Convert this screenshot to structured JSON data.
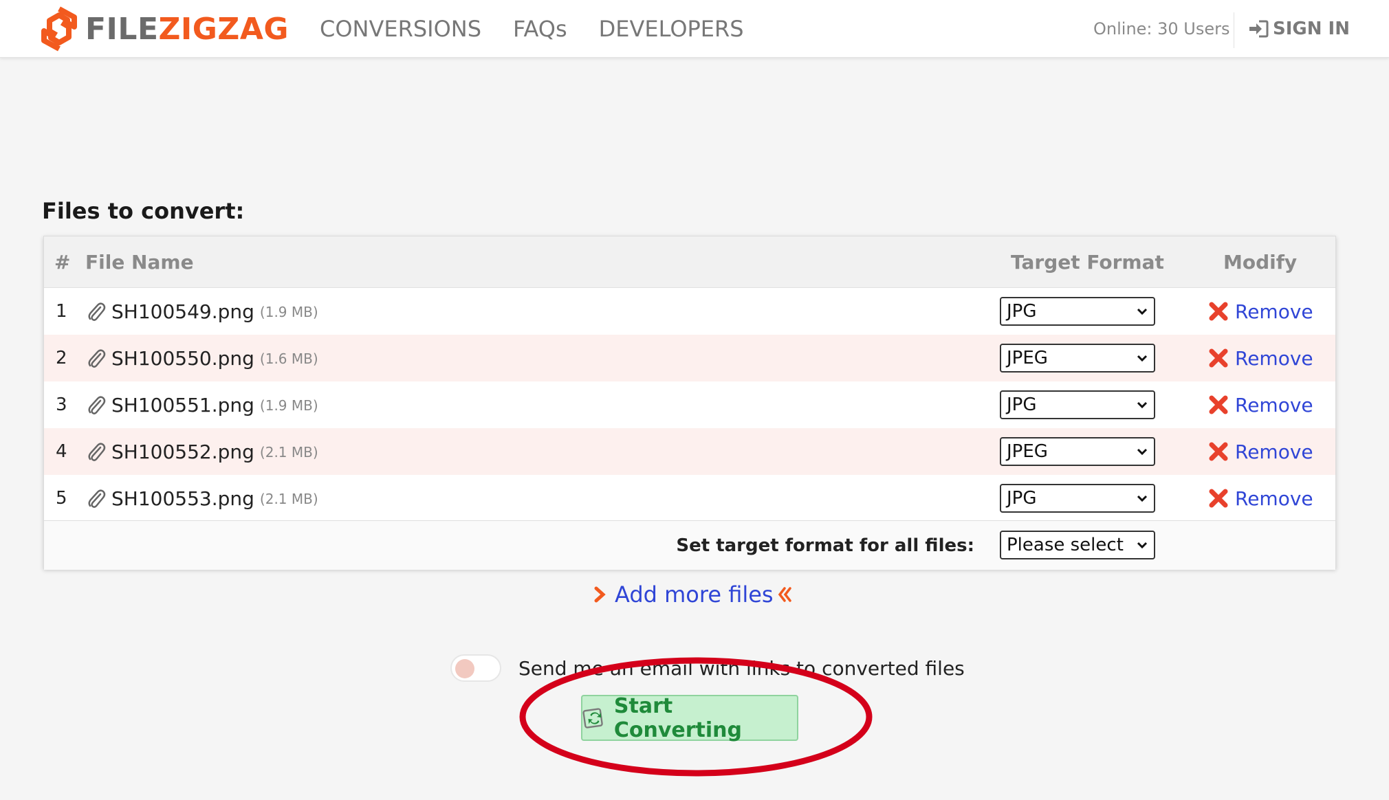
{
  "header": {
    "logo_part1": "FILE",
    "logo_part2": "ZIGZAG",
    "nav": [
      "CONVERSIONS",
      "FAQs",
      "DEVELOPERS"
    ],
    "online": "Online: 30 Users",
    "signin": "SIGN IN"
  },
  "files_section": {
    "title": "Files to convert:",
    "columns": {
      "num": "#",
      "name": "File Name",
      "format": "Target Format",
      "modify": "Modify"
    },
    "rows": [
      {
        "num": "1",
        "name": "SH100549.png",
        "size": "(1.9 MB)",
        "format": "JPG",
        "action": "Remove"
      },
      {
        "num": "2",
        "name": "SH100550.png",
        "size": "(1.6 MB)",
        "format": "JPEG",
        "action": "Remove"
      },
      {
        "num": "3",
        "name": "SH100551.png",
        "size": "(1.9 MB)",
        "format": "JPG",
        "action": "Remove"
      },
      {
        "num": "4",
        "name": "SH100552.png",
        "size": "(2.1 MB)",
        "format": "JPEG",
        "action": "Remove"
      },
      {
        "num": "5",
        "name": "SH100553.png",
        "size": "(2.1 MB)",
        "format": "JPG",
        "action": "Remove"
      }
    ],
    "all_files_label": "Set target format for all files:",
    "all_files_value": "Please select"
  },
  "add_more": "Add more files",
  "email_toggle": {
    "label": "Send me an email with links to converted files",
    "enabled": false
  },
  "start_button": "Start Converting",
  "colors": {
    "brand_orange": "#f25a1e",
    "link_blue": "#2f45d6",
    "remove_red": "#e8412c",
    "button_green_bg": "#c6f0cf",
    "button_green_text": "#1f8a3a",
    "annotation_red": "#d4001a",
    "alt_row": "#fdf0ee"
  },
  "icons": {
    "logo": "zigzag-logo-icon",
    "signin": "sign-in-icon",
    "attachment": "paperclip-icon",
    "remove": "x-mark-icon",
    "select": "chevron-down-icon",
    "add_more": "double-arrow-icon",
    "start": "convert-refresh-icon"
  }
}
